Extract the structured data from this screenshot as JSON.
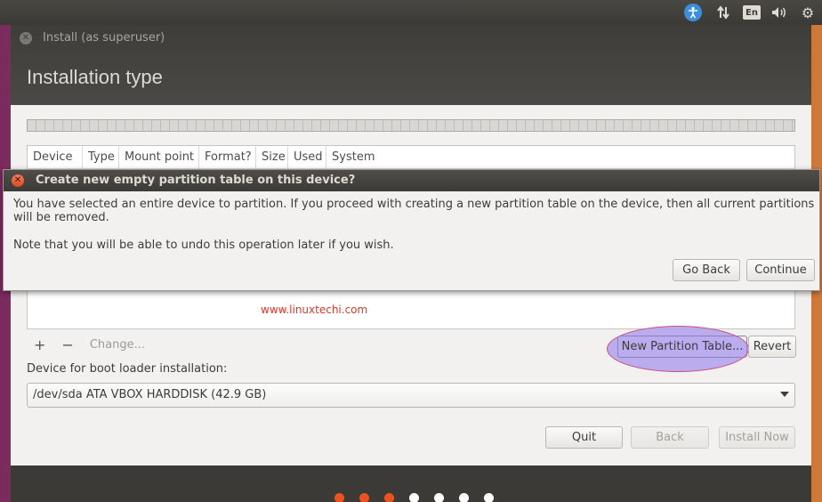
{
  "window": {
    "title": "Install (as superuser)",
    "heading": "Installation type"
  },
  "partition_table": {
    "columns": [
      "Device",
      "Type",
      "Mount point",
      "Format?",
      "Size",
      "Used",
      "System"
    ],
    "rows": []
  },
  "watermark": "www.linuxtechi.com",
  "toolbar": {
    "add_label": "+",
    "remove_label": "−",
    "change_label": "Change...",
    "new_partition_table_label": "New Partition Table...",
    "revert_label": "Revert"
  },
  "bootloader": {
    "label": "Device for boot loader installation:",
    "selected": "/dev/sda ATA VBOX HARDDISK (42.9 GB)"
  },
  "footer": {
    "quit_label": "Quit",
    "back_label": "Back",
    "install_label": "Install Now"
  },
  "dialog": {
    "title": "Create new empty partition table on this device?",
    "message": "You have selected an entire device to partition. If you proceed with creating a new partition table on the device, then all current partitions will be removed.",
    "note": "Note that you will be able to undo this operation later if you wish.",
    "go_back_label": "Go Back",
    "continue_label": "Continue"
  },
  "topbar": {
    "language": "En",
    "icons": [
      "accessibility-icon",
      "network-icon",
      "keyboard-language-icon",
      "volume-icon",
      "settings-gear-icon"
    ]
  },
  "progress": {
    "steps_total": 7,
    "steps_done": 3,
    "done_color": "#e95420",
    "todo_color": "#ffffff"
  },
  "colors": {
    "accent": "#e95420",
    "highlight": "#b2a0ee",
    "titlebar": "#3c3b37"
  }
}
